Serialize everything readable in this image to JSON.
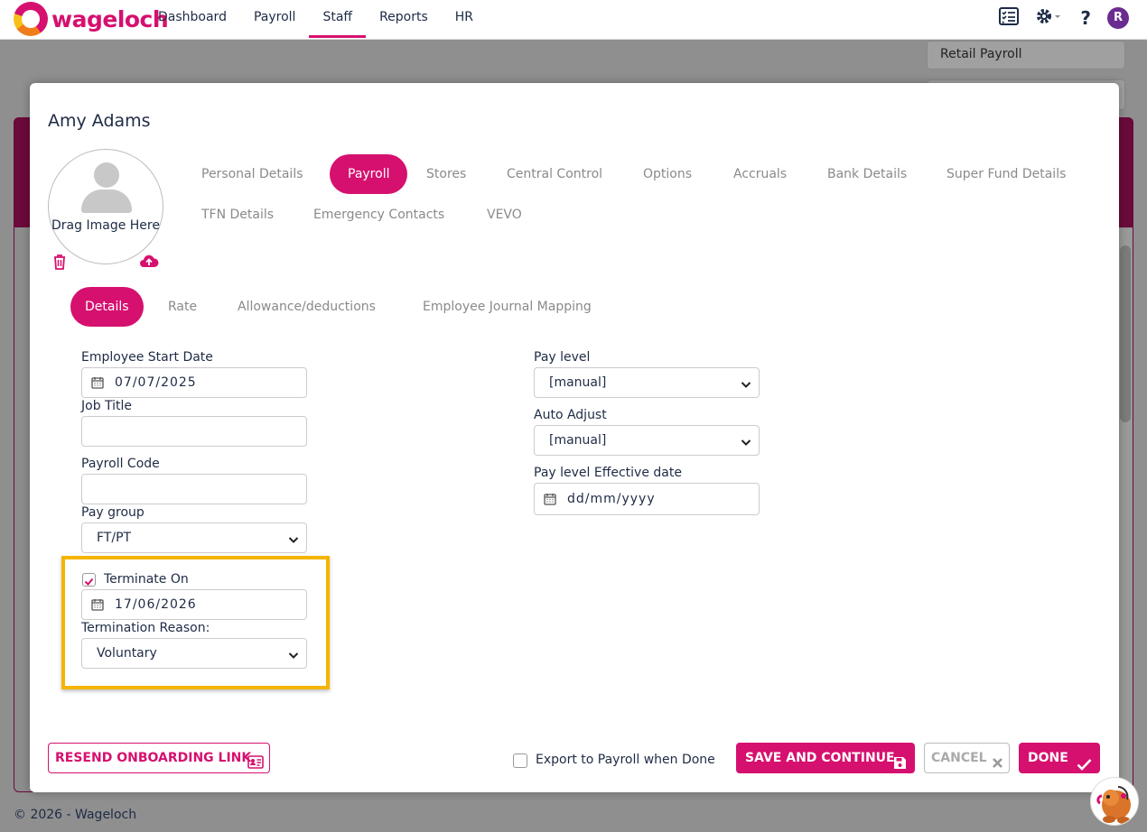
{
  "app": {
    "brand": "wageloch"
  },
  "nav": {
    "items": [
      "Dashboard",
      "Payroll",
      "Staff",
      "Reports",
      "HR"
    ],
    "active": "Staff",
    "user_initial": "R"
  },
  "background": {
    "payroll_select": "Retail Payroll",
    "footer": "© 2026 - Wageloch"
  },
  "modal": {
    "employee_name": "Amy Adams",
    "photo_text": "Drag Image Here",
    "main_tabs": [
      "Personal Details",
      "Payroll",
      "Stores",
      "Central Control",
      "Options",
      "Accruals",
      "Bank Details",
      "Super Fund Details",
      "TFN Details",
      "Emergency Contacts",
      "VEVO"
    ],
    "main_tab_active": "Payroll",
    "sub_tabs": [
      "Details",
      "Rate",
      "Allowance/deductions",
      "Employee Journal Mapping"
    ],
    "sub_tab_active": "Details",
    "form": {
      "start_date_label": "Employee Start Date",
      "start_date_value": "07/07/2025",
      "job_title_label": "Job Title",
      "job_title_value": "",
      "payroll_code_label": "Payroll Code",
      "payroll_code_value": "",
      "pay_group_label": "Pay group",
      "pay_group_value": "FT/PT",
      "terminate_label": "Terminate On",
      "terminate_checked": true,
      "terminate_date": "17/06/2026",
      "termination_reason_label": "Termination Reason:",
      "termination_reason_value": "Voluntary",
      "pay_level_label": "Pay level",
      "pay_level_value": "[manual]",
      "auto_adjust_label": "Auto Adjust",
      "auto_adjust_value": "[manual]",
      "pay_level_effective_label": "Pay level Effective date",
      "pay_level_effective_placeholder": "dd/mm/yyyy"
    },
    "footer": {
      "resend_label": "RESEND ONBOARDING LINK",
      "export_label": "Export to Payroll when Done",
      "save_label": "SAVE AND CONTINUE",
      "cancel_label": "CANCEL",
      "done_label": "DONE"
    }
  },
  "colors": {
    "accent": "#d6106f",
    "highlight": "#f5b400",
    "text": "#1e2b45"
  }
}
